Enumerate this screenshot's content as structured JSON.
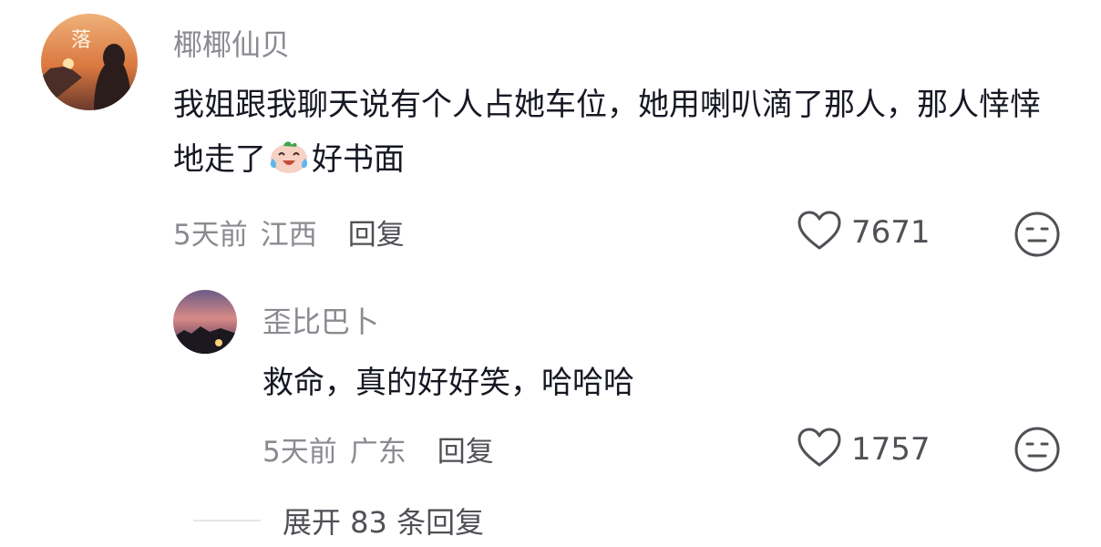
{
  "comments": [
    {
      "username": "椰椰仙贝",
      "avatar": "avatar-sunset-girl",
      "content_part1": "我姐跟我聊天说有个人占她车位，她用喇叭滴了那人，那人悻悻地走了",
      "content_emoji": "crying-laughing-emoji",
      "content_part2": "好书面",
      "time": "5天前",
      "location": "江西",
      "reply_label": "回复",
      "like_count": "7671"
    }
  ],
  "replies": [
    {
      "username": "歪比巴卜",
      "avatar": "avatar-dusk-sky",
      "content": "救命，真的好好笑，哈哈哈",
      "time": "5天前",
      "location": "广东",
      "reply_label": "回复",
      "like_count": "1757"
    }
  ],
  "expand": {
    "label": "展开 83 条回复"
  },
  "colors": {
    "username": "#8a8b91",
    "text": "#161823",
    "meta": "#8a8b91",
    "action": "#505156"
  }
}
